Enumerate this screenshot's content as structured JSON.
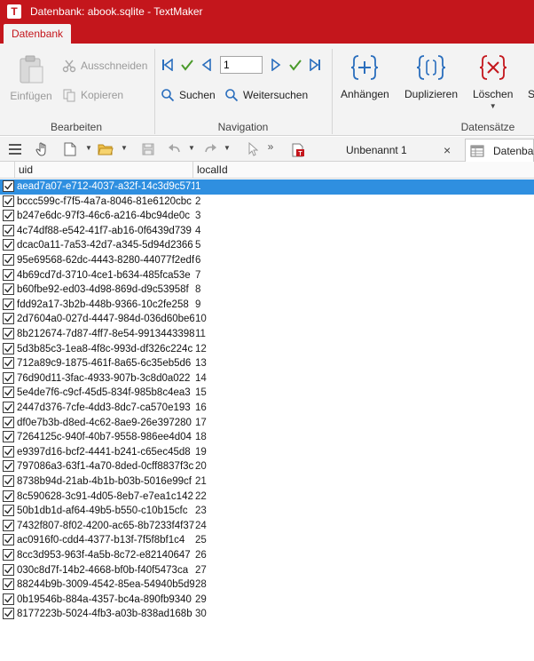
{
  "window": {
    "title": "Datenbank: abook.sqlite - TextMaker",
    "app_letter": "T"
  },
  "ribbon_tabs": [
    {
      "label": "Datenbank"
    }
  ],
  "ribbon": {
    "bearbeiten": {
      "label": "Bearbeiten",
      "paste": "Einfügen",
      "cut": "Ausschneiden",
      "copy": "Kopieren"
    },
    "navigation": {
      "label": "Navigation",
      "record_number": "1",
      "search": "Suchen",
      "search_next": "Weitersuchen"
    },
    "datensaetze": {
      "label": "Datensätze",
      "append": "Anhängen",
      "duplicate": "Duplizieren",
      "delete": "Löschen",
      "cut_off": "S"
    }
  },
  "doc_tabs": [
    {
      "label": "Unbenannt 1",
      "close": "×"
    },
    {
      "label": "Datenba"
    }
  ],
  "grid": {
    "columns": [
      "uid",
      "localId"
    ],
    "rows": [
      {
        "uid": "aead7a07-e712-4037-a32f-14c3d9c571",
        "localId": "1"
      },
      {
        "uid": "bccc599c-f7f5-4a7a-8046-81e6120cbc",
        "localId": "2"
      },
      {
        "uid": "b247e6dc-97f3-46c6-a216-4bc94de0c",
        "localId": "3"
      },
      {
        "uid": "4c74df88-e542-41f7-ab16-0f6439d739",
        "localId": "4"
      },
      {
        "uid": "dcac0a11-7a53-42d7-a345-5d94d2366",
        "localId": "5"
      },
      {
        "uid": "95e69568-62dc-4443-8280-44077f2edf",
        "localId": "6"
      },
      {
        "uid": "4b69cd7d-3710-4ce1-b634-485fca53e",
        "localId": "7"
      },
      {
        "uid": "b60fbe92-ed03-4d98-869d-d9c53958f",
        "localId": "8"
      },
      {
        "uid": "fdd92a17-3b2b-448b-9366-10c2fe258",
        "localId": "9"
      },
      {
        "uid": "2d7604a0-027d-4447-984d-036d60be6",
        "localId": "10"
      },
      {
        "uid": "8b212674-7d87-4ff7-8e54-9913443398",
        "localId": "11"
      },
      {
        "uid": "5d3b85c3-1ea8-4f8c-993d-df326c224c",
        "localId": "12"
      },
      {
        "uid": "712a89c9-1875-461f-8a65-6c35eb5d6",
        "localId": "13"
      },
      {
        "uid": "76d90d11-3fac-4933-907b-3c8d0a022",
        "localId": "14"
      },
      {
        "uid": "5e4de7f6-c9cf-45d5-834f-985b8c4ea3",
        "localId": "15"
      },
      {
        "uid": "2447d376-7cfe-4dd3-8dc7-ca570e193",
        "localId": "16"
      },
      {
        "uid": "df0e7b3b-d8ed-4c62-8ae9-26e397280",
        "localId": "17"
      },
      {
        "uid": "7264125c-940f-40b7-9558-986ee4d04",
        "localId": "18"
      },
      {
        "uid": "e9397d16-bcf2-4441-b241-c65ec45d8",
        "localId": "19"
      },
      {
        "uid": "797086a3-63f1-4a70-8ded-0cff8837f3c",
        "localId": "20"
      },
      {
        "uid": "8738b94d-21ab-4b1b-b03b-5016e99cf",
        "localId": "21"
      },
      {
        "uid": "8c590628-3c91-4d05-8eb7-e7ea1c142",
        "localId": "22"
      },
      {
        "uid": "50b1db1d-af64-49b5-b550-c10b15cfc",
        "localId": "23"
      },
      {
        "uid": "7432f807-8f02-4200-ac65-8b7233f4f37",
        "localId": "24"
      },
      {
        "uid": "ac0916f0-cdd4-4377-b13f-7f5f8bf1c4",
        "localId": "25"
      },
      {
        "uid": "8cc3d953-963f-4a5b-8c72-e82140647",
        "localId": "26"
      },
      {
        "uid": "030c8d7f-14b2-4668-bf0b-f40f5473ca",
        "localId": "27"
      },
      {
        "uid": "88244b9b-3009-4542-85ea-54940b5d9",
        "localId": "28"
      },
      {
        "uid": "0b19546b-884a-4357-bc4a-890fb9340",
        "localId": "29"
      },
      {
        "uid": "8177223b-5024-4fb3-a03b-838ad168b",
        "localId": "30"
      }
    ]
  },
  "colors": {
    "accent": "#c4161c",
    "selection": "#2f8fe0",
    "blue_icon": "#2a6ebd",
    "green_icon": "#4a9a2a"
  }
}
